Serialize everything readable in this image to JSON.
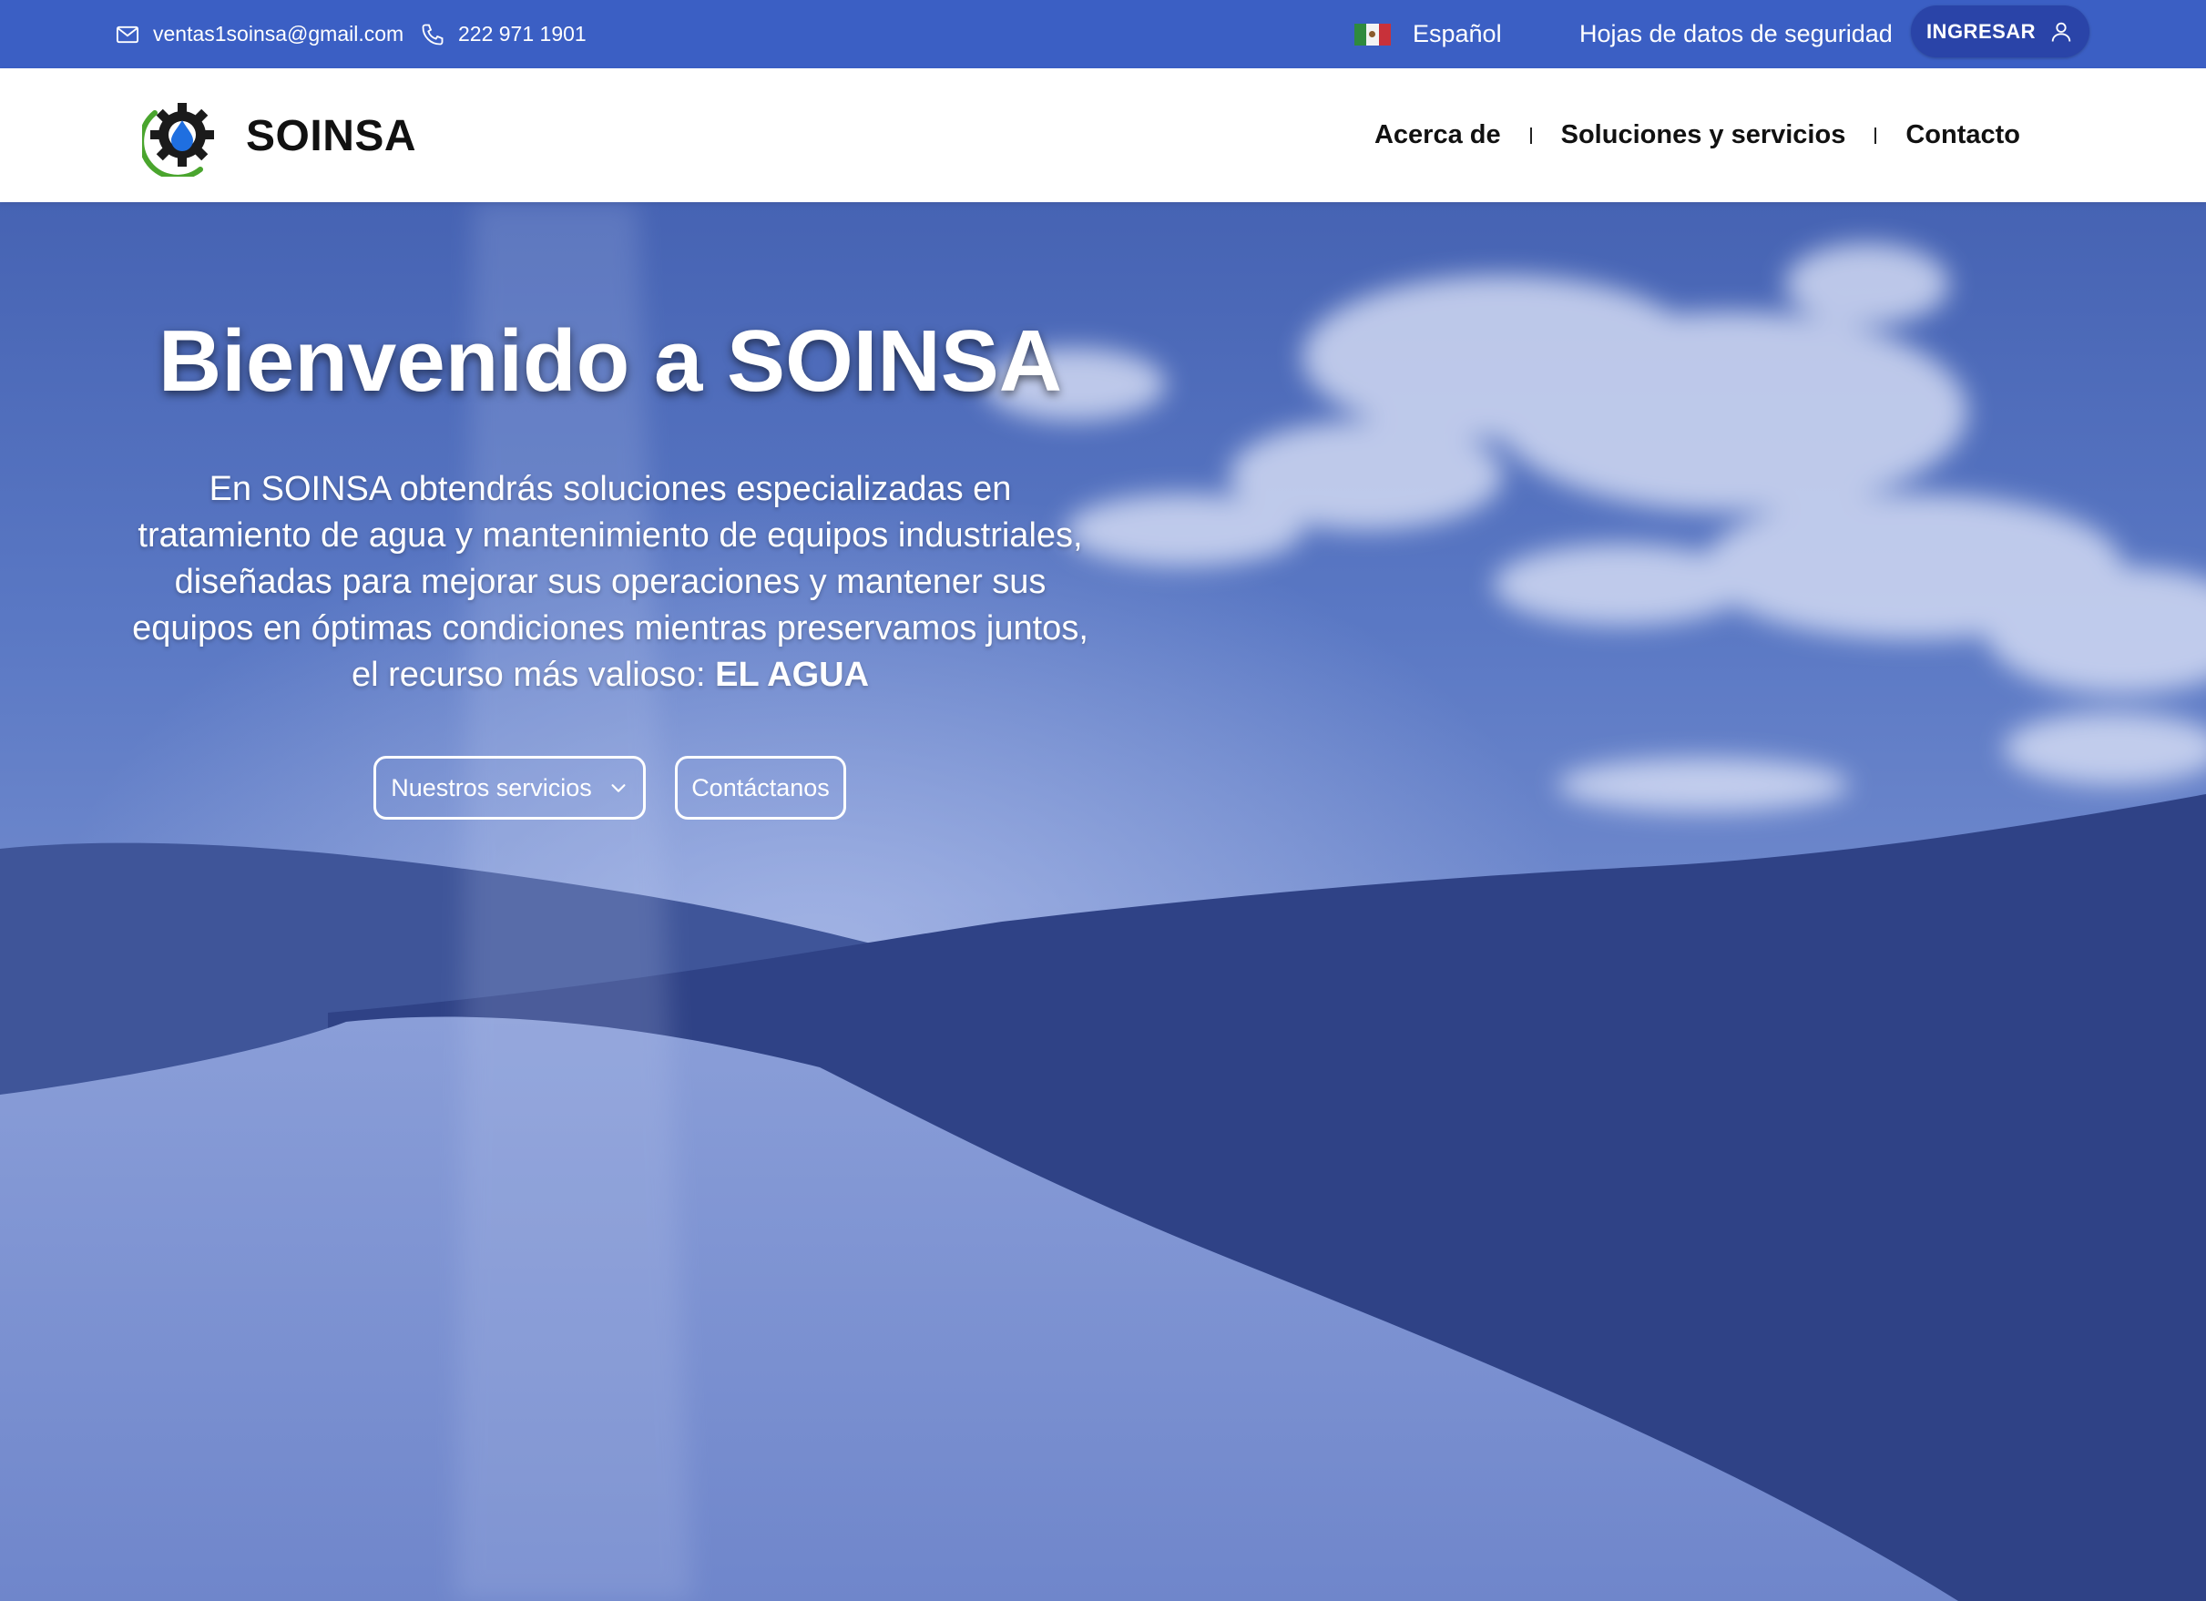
{
  "topbar": {
    "email": "ventas1soinsa@gmail.com",
    "phone": "222 971 1901",
    "language": "Español",
    "safety_sheets": "Hojas de datos de seguridad",
    "login": "INGRESAR"
  },
  "navbar": {
    "brand": "SOINSA",
    "links": [
      "Acerca de",
      "Soluciones y servicios",
      "Contacto"
    ]
  },
  "hero": {
    "title": "Bienvenido a SOINSA",
    "text_lines": [
      "En SOINSA obtendrás soluciones especializadas en",
      "tratamiento de agua y mantenimiento de equipos industriales,",
      "diseñadas para mejorar sus operaciones y mantener sus",
      "equipos en óptimas condiciones mientras preservamos juntos,",
      "el recurso más valioso:"
    ],
    "highlight": "EL AGUA",
    "buttons": {
      "services": "Nuestros servicios",
      "contact": "Contáctanos"
    }
  },
  "colors": {
    "topbar_bg": "#3b5fc4",
    "login_bg": "#2a44a8",
    "hero_tint": "#4a63b4"
  },
  "icons": [
    "mail-icon",
    "phone-icon",
    "mexico-flag-icon",
    "user-icon",
    "logo-gear-drop-icon",
    "chevron-down-icon"
  ]
}
